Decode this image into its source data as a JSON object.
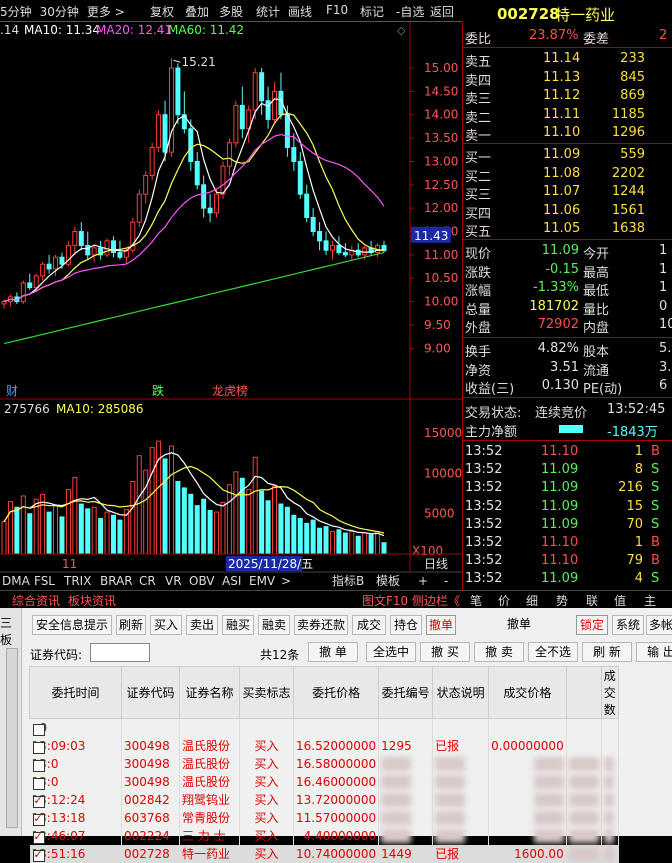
{
  "toolbar": {
    "periods": [
      "5分钟",
      "30分钟",
      "更多 >"
    ],
    "buttons": [
      "复权",
      "叠加",
      "多股",
      "统计",
      "画线",
      "F10",
      "标记",
      "-自选",
      "返回"
    ]
  },
  "stock": {
    "code": "002728",
    "name": "特一药业"
  },
  "ma_legend": {
    "prefix": ".14",
    "ma10": "MA10: 11.34",
    "ma20": "MA20: 12.41",
    "ma60": "MA60: 11.42"
  },
  "price_axis": [
    "15.00",
    "14.50",
    "14.00",
    "13.50",
    "13.00",
    "12.50",
    "12.00",
    "11.50",
    "11.00",
    "10.50",
    "10.00",
    "9.50",
    "9.00"
  ],
  "high_label": "15.21",
  "current_price_tag": "11.43",
  "markers": [
    "财",
    "跌",
    "龙虎榜"
  ],
  "vol_legend": {
    "vol": "275766",
    "ma10": "MA10: 285086"
  },
  "vol_axis": [
    "15000",
    "10000",
    "5000",
    "X100"
  ],
  "date_label": "2025/11/28/五",
  "x_label": "11",
  "indicator_tabs": [
    "DMA",
    "FSL",
    "TRIX",
    "BRAR",
    "CR",
    "VR",
    "OBV",
    "ASI",
    "EMV",
    ">"
  ],
  "indicator_right": [
    "指标B",
    "模板",
    "+",
    "-"
  ],
  "day_label": "日线",
  "left_bottom_tabs": [
    "综合资讯",
    "板块资讯"
  ],
  "right_bottom_tabs": [
    "图文F10",
    "侧边栏《",
    "笔",
    "价",
    "细",
    "势",
    "联",
    "值",
    "主"
  ],
  "quote": {
    "wb_label": "委比",
    "wb": "23.87%",
    "wc_label": "委差",
    "wc": "2",
    "asks": [
      {
        "label": "卖五",
        "price": "11.14",
        "vol": "233"
      },
      {
        "label": "卖四",
        "price": "11.13",
        "vol": "845"
      },
      {
        "label": "卖三",
        "price": "11.12",
        "vol": "869"
      },
      {
        "label": "卖二",
        "price": "11.11",
        "vol": "1185"
      },
      {
        "label": "卖一",
        "price": "11.10",
        "vol": "1296"
      }
    ],
    "bids": [
      {
        "label": "买一",
        "price": "11.09",
        "vol": "559"
      },
      {
        "label": "买二",
        "price": "11.08",
        "vol": "2202"
      },
      {
        "label": "买三",
        "price": "11.07",
        "vol": "1244"
      },
      {
        "label": "买四",
        "price": "11.06",
        "vol": "1561"
      },
      {
        "label": "买五",
        "price": "11.05",
        "vol": "1638"
      }
    ],
    "stats": [
      {
        "l1": "现价",
        "v1": "11.09",
        "c1": "gv",
        "l2": "今开",
        "v2": "1"
      },
      {
        "l1": "涨跌",
        "v1": "-0.15",
        "c1": "gv",
        "l2": "最高",
        "v2": "1"
      },
      {
        "l1": "涨幅",
        "v1": "-1.33%",
        "c1": "gv",
        "l2": "最低",
        "v2": "1"
      },
      {
        "l1": "总量",
        "v1": "181702",
        "c1": "yv",
        "l2": "量比",
        "v2": "0"
      },
      {
        "l1": "外盘",
        "v1": "72902",
        "c1": "pv",
        "l2": "内盘",
        "v2": "108"
      }
    ],
    "stats2": [
      {
        "l1": "换手",
        "v1": "4.82%",
        "l2": "股本",
        "v2": "5.1"
      },
      {
        "l1": "净资",
        "v1": "3.51",
        "l2": "流通",
        "v2": "3.7"
      },
      {
        "l1": "收益(三)",
        "v1": "0.130",
        "l2": "PE(动)",
        "v2": "6"
      }
    ],
    "status_label": "交易状态:",
    "status": "连续竞价",
    "status_time": "13:52:45",
    "net_label": "主力净额",
    "net": "-1843万",
    "ticks": [
      {
        "t": "13:52",
        "p": "11.10",
        "v": "1",
        "d": "B",
        "c": "pv"
      },
      {
        "t": "13:52",
        "p": "11.09",
        "v": "8",
        "d": "S",
        "c": "gv"
      },
      {
        "t": "13:52",
        "p": "11.09",
        "v": "216",
        "d": "S",
        "c": "gv"
      },
      {
        "t": "13:52",
        "p": "11.09",
        "v": "15",
        "d": "S",
        "c": "gv"
      },
      {
        "t": "13:52",
        "p": "11.09",
        "v": "70",
        "d": "S",
        "c": "gv"
      },
      {
        "t": "13:52",
        "p": "11.10",
        "v": "1",
        "d": "B",
        "c": "pv"
      },
      {
        "t": "13:52",
        "p": "11.10",
        "v": "79",
        "d": "B",
        "c": "pv"
      },
      {
        "t": "13:52",
        "p": "11.09",
        "v": "4",
        "d": "S",
        "c": "gv"
      }
    ]
  },
  "trade": {
    "side_label": "三板",
    "buttons1": [
      "安全信息提示",
      "刷新",
      "买入",
      "卖出",
      "融买",
      "融卖",
      "卖券还款",
      "成交",
      "持仓",
      "撤单",
      "撤单",
      "锁定",
      "系统",
      "多帐"
    ],
    "code_label": "证券代码:",
    "count": "共12条",
    "buttons2": [
      "撤 单",
      "全选中",
      "撤 买",
      "撤 卖",
      "全不选",
      "刷 新",
      "输 出"
    ],
    "headers": [
      "委托时间",
      "证券代码",
      "证券名称",
      "买卖标志",
      "委托价格",
      "委托编号",
      "状态说明",
      "成交价格",
      "",
      "成交数"
    ],
    "rows": [
      {
        "chk": false,
        "time": "0",
        "code": "",
        "name": "",
        "side": "",
        "price": "",
        "id": "",
        "status": "",
        "deal": "",
        "blue": true
      },
      {
        "chk": false,
        "time": "13:09:03",
        "code": "300498",
        "name": "温氏股份",
        "side": "买入",
        "price": "16.52000000",
        "id": "1295",
        "status": "已报",
        "deal": "0.00000000"
      },
      {
        "chk": false,
        "time": "13:0",
        "code": "300498",
        "name": "温氏股份",
        "side": "买入",
        "price": "16.58000000",
        "id": "",
        "status": "",
        "deal": ""
      },
      {
        "chk": false,
        "time": "13:0",
        "code": "300498",
        "name": "温氏股份",
        "side": "买入",
        "price": "16.46000000",
        "id": "",
        "status": "",
        "deal": ""
      },
      {
        "chk": true,
        "time": "13:12:24",
        "code": "002842",
        "name": "翔鹭钨业",
        "side": "买入",
        "price": "13.72000000",
        "id": "",
        "status": "",
        "deal": ""
      },
      {
        "chk": true,
        "time": "13:13:18",
        "code": "603768",
        "name": "常青股份",
        "side": "买入",
        "price": "11.57000000",
        "id": "",
        "status": "",
        "deal": ""
      },
      {
        "chk": true,
        "time": "13:46:07",
        "code": "002224",
        "name": "三 力 士",
        "side": "买入",
        "price": "4.40000000",
        "id": "",
        "status": "",
        "deal": ""
      },
      {
        "chk": true,
        "time": "13:51:16",
        "code": "002728",
        "name": "特一药业",
        "side": "买入",
        "price": "10.74000000",
        "id": "1449",
        "status": "已报",
        "deal": "1600.00"
      }
    ]
  },
  "chart_data": {
    "type": "candlestick",
    "ylim": [
      8.6,
      15.6
    ],
    "candles": [
      [
        9.95,
        10.05,
        9.85,
        10.0
      ],
      [
        10.0,
        10.15,
        9.9,
        10.1
      ],
      [
        10.1,
        10.2,
        9.95,
        10.0
      ],
      [
        10.0,
        10.45,
        9.95,
        10.4
      ],
      [
        10.4,
        10.6,
        10.25,
        10.3
      ],
      [
        10.3,
        10.6,
        10.2,
        10.55
      ],
      [
        10.55,
        10.85,
        10.45,
        10.8
      ],
      [
        10.8,
        11.0,
        10.6,
        10.7
      ],
      [
        10.7,
        11.0,
        10.55,
        10.95
      ],
      [
        10.95,
        11.05,
        10.7,
        10.8
      ],
      [
        10.8,
        11.3,
        10.75,
        11.2
      ],
      [
        11.2,
        11.6,
        11.0,
        11.5
      ],
      [
        11.5,
        11.7,
        11.1,
        11.2
      ],
      [
        11.2,
        11.5,
        10.9,
        11.0
      ],
      [
        11.0,
        11.2,
        10.85,
        11.15
      ],
      [
        11.15,
        11.3,
        10.9,
        11.0
      ],
      [
        11.0,
        11.35,
        10.95,
        11.3
      ],
      [
        11.3,
        11.4,
        10.95,
        11.05
      ],
      [
        11.05,
        11.3,
        10.9,
        10.95
      ],
      [
        10.95,
        11.15,
        10.8,
        11.1
      ],
      [
        11.1,
        11.8,
        11.05,
        11.7
      ],
      [
        11.7,
        12.4,
        11.6,
        12.3
      ],
      [
        12.3,
        12.8,
        12.1,
        12.7
      ],
      [
        12.7,
        13.4,
        12.6,
        13.3
      ],
      [
        13.3,
        14.1,
        13.2,
        14.0
      ],
      [
        14.0,
        14.3,
        13.0,
        13.2
      ],
      [
        13.2,
        15.21,
        13.1,
        15.0
      ],
      [
        15.0,
        15.1,
        13.8,
        14.0
      ],
      [
        14.0,
        14.5,
        13.6,
        13.7
      ],
      [
        13.7,
        13.9,
        12.8,
        13.0
      ],
      [
        13.0,
        13.2,
        12.4,
        12.5
      ],
      [
        12.5,
        12.7,
        11.8,
        12.0
      ],
      [
        12.0,
        12.3,
        11.7,
        11.9
      ],
      [
        11.9,
        12.4,
        11.8,
        12.3
      ],
      [
        12.3,
        13.0,
        12.2,
        12.9
      ],
      [
        12.9,
        13.5,
        12.7,
        13.4
      ],
      [
        13.4,
        14.3,
        13.3,
        14.2
      ],
      [
        14.2,
        14.6,
        13.5,
        13.7
      ],
      [
        13.7,
        14.2,
        13.4,
        14.1
      ],
      [
        14.1,
        15.0,
        13.9,
        14.9
      ],
      [
        14.9,
        15.0,
        14.0,
        14.3
      ],
      [
        14.3,
        14.6,
        13.7,
        13.9
      ],
      [
        13.9,
        14.7,
        13.8,
        14.5
      ],
      [
        14.5,
        14.9,
        13.9,
        14.0
      ],
      [
        14.0,
        14.2,
        13.1,
        13.3
      ],
      [
        13.3,
        13.6,
        12.8,
        13.0
      ],
      [
        13.0,
        13.2,
        12.2,
        12.3
      ],
      [
        12.3,
        12.5,
        11.7,
        11.8
      ],
      [
        11.8,
        12.0,
        11.4,
        11.5
      ],
      [
        11.5,
        11.7,
        11.1,
        11.3
      ],
      [
        11.3,
        11.5,
        11.0,
        11.1
      ],
      [
        11.1,
        11.3,
        10.9,
        11.2
      ],
      [
        11.2,
        11.4,
        11.0,
        11.05
      ],
      [
        11.05,
        11.25,
        10.95,
        11.0
      ],
      [
        11.0,
        11.2,
        10.9,
        11.1
      ],
      [
        11.1,
        11.25,
        10.95,
        11.0
      ],
      [
        11.0,
        11.2,
        10.9,
        11.15
      ],
      [
        11.15,
        11.3,
        11.0,
        11.05
      ],
      [
        11.05,
        11.25,
        10.95,
        11.2
      ],
      [
        11.2,
        11.3,
        11.05,
        11.09
      ]
    ],
    "volume": [
      4000,
      6500,
      5800,
      7200,
      5000,
      6800,
      7400,
      5200,
      6000,
      4600,
      8000,
      9500,
      6200,
      5600,
      5800,
      4400,
      5200,
      4800,
      4200,
      5500,
      9000,
      12200,
      10400,
      13200,
      14000,
      11800,
      13400,
      9000,
      8200,
      7400,
      6000,
      6800,
      5400,
      5200,
      6400,
      8600,
      10200,
      9400,
      8000,
      12000,
      7800,
      6600,
      8400,
      6200,
      5800,
      4800,
      4400,
      3800,
      4200,
      3200,
      3400,
      2800,
      3000,
      2600,
      2800,
      2200,
      2600,
      2400,
      2800,
      1400
    ],
    "vol_ylim": [
      0,
      17000
    ]
  }
}
